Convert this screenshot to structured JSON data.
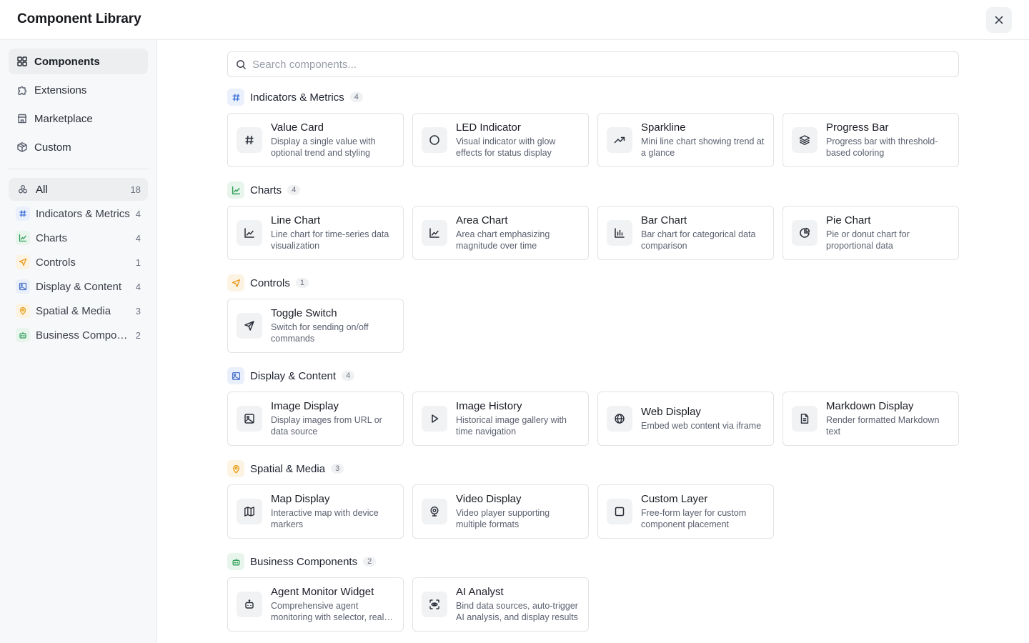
{
  "header": {
    "title": "Component Library"
  },
  "nav": [
    {
      "label": "Components",
      "icon": "grid-icon"
    },
    {
      "label": "Extensions",
      "icon": "puzzle-icon"
    },
    {
      "label": "Marketplace",
      "icon": "store-icon"
    },
    {
      "label": "Custom",
      "icon": "package-icon"
    }
  ],
  "categories": [
    {
      "label": "All",
      "count": "18"
    },
    {
      "label": "Indicators & Metrics",
      "count": "4"
    },
    {
      "label": "Charts",
      "count": "4"
    },
    {
      "label": "Controls",
      "count": "1"
    },
    {
      "label": "Display & Content",
      "count": "4"
    },
    {
      "label": "Spatial & Media",
      "count": "3"
    },
    {
      "label": "Business Components",
      "count": "2"
    }
  ],
  "search": {
    "placeholder": "Search components..."
  },
  "sections": [
    {
      "label": "Indicators & Metrics",
      "count": "4",
      "items": [
        {
          "title": "Value Card",
          "desc": "Display a single value with optional trend and styling"
        },
        {
          "title": "LED Indicator",
          "desc": "Visual indicator with glow effects for status display"
        },
        {
          "title": "Sparkline",
          "desc": "Mini line chart showing trend at a glance"
        },
        {
          "title": "Progress Bar",
          "desc": "Progress bar with threshold-based coloring"
        }
      ]
    },
    {
      "label": "Charts",
      "count": "4",
      "items": [
        {
          "title": "Line Chart",
          "desc": "Line chart for time-series data visualization"
        },
        {
          "title": "Area Chart",
          "desc": "Area chart emphasizing magnitude over time"
        },
        {
          "title": "Bar Chart",
          "desc": "Bar chart for categorical data comparison"
        },
        {
          "title": "Pie Chart",
          "desc": "Pie or donut chart for proportional data"
        }
      ]
    },
    {
      "label": "Controls",
      "count": "1",
      "items": [
        {
          "title": "Toggle Switch",
          "desc": "Switch for sending on/off commands"
        }
      ]
    },
    {
      "label": "Display & Content",
      "count": "4",
      "items": [
        {
          "title": "Image Display",
          "desc": "Display images from URL or data source"
        },
        {
          "title": "Image History",
          "desc": "Historical image gallery with time navigation"
        },
        {
          "title": "Web Display",
          "desc": "Embed web content via iframe"
        },
        {
          "title": "Markdown Display",
          "desc": "Render formatted Markdown text"
        }
      ]
    },
    {
      "label": "Spatial & Media",
      "count": "3",
      "items": [
        {
          "title": "Map Display",
          "desc": "Interactive map with device markers"
        },
        {
          "title": "Video Display",
          "desc": "Video player supporting multiple formats"
        },
        {
          "title": "Custom Layer",
          "desc": "Free-form layer for custom component placement"
        }
      ]
    },
    {
      "label": "Business Components",
      "count": "2",
      "items": [
        {
          "title": "Agent Monitor Widget",
          "desc": "Comprehensive agent monitoring with selector, real-time status and logs"
        },
        {
          "title": "AI Analyst",
          "desc": "Bind data sources, auto-trigger AI analysis, and display results"
        }
      ]
    }
  ],
  "colors": {
    "indicators": "#3b6fd8",
    "charts": "#2f9e57",
    "controls": "#e89a1c",
    "display": "#4a72c9",
    "spatial": "#e8a01c",
    "business": "#2f9e57"
  }
}
